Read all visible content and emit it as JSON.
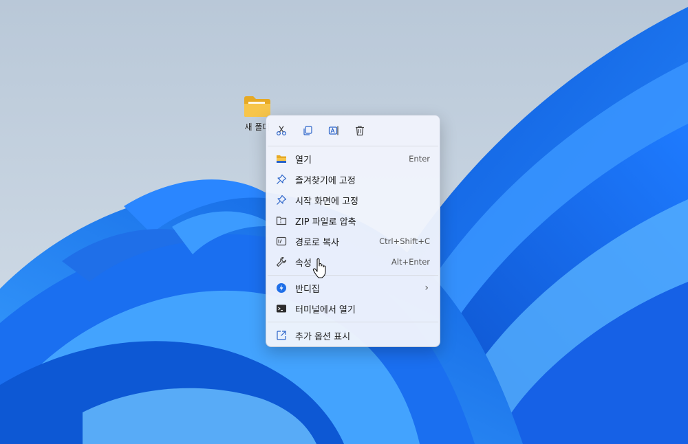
{
  "desktop": {
    "folder_label": "새 폴더",
    "folder_icon": "folder-icon"
  },
  "context_menu": {
    "toolbar": [
      {
        "name": "cut-icon"
      },
      {
        "name": "copy-icon"
      },
      {
        "name": "rename-icon"
      },
      {
        "name": "delete-icon"
      }
    ],
    "items": [
      {
        "label": "열기",
        "shortcut": "Enter",
        "icon": "folder-open-icon"
      },
      {
        "label": "즐겨찾기에 고정",
        "shortcut": "",
        "icon": "pin-icon"
      },
      {
        "label": "시작 화면에 고정",
        "shortcut": "",
        "icon": "pin-icon"
      },
      {
        "label": "ZIP 파일로 압축",
        "shortcut": "",
        "icon": "zip-icon"
      },
      {
        "label": "경로로 복사",
        "shortcut": "Ctrl+Shift+C",
        "icon": "copy-path-icon"
      },
      {
        "label": "속성",
        "shortcut": "Alt+Enter",
        "icon": "wrench-icon"
      },
      {
        "label": "반디집",
        "shortcut": "",
        "icon": "bandizip-icon",
        "submenu": true
      },
      {
        "label": "터미널에서 열기",
        "shortcut": "",
        "icon": "terminal-icon"
      },
      {
        "label": "추가 옵션 표시",
        "shortcut": "",
        "icon": "more-options-icon"
      }
    ]
  },
  "colors": {
    "wallpaper_sky": "#c9d6e3",
    "bloom_blue": "#1a6ff0",
    "accent_icon": "#2b64c9"
  }
}
